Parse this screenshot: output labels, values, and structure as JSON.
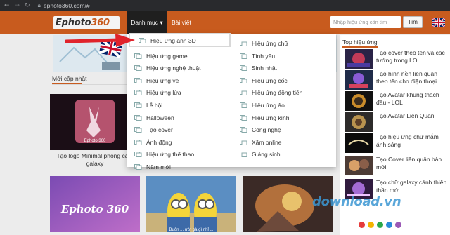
{
  "browser": {
    "back_icon": "arrow-left-icon",
    "forward_icon": "arrow-right-icon",
    "reload_icon": "reload-icon",
    "lock_icon": "lock-icon",
    "url": "ephoto360.com/#"
  },
  "header": {
    "logo_prefix": "Ephoto",
    "logo_suffix": "360",
    "menu_danhmuc": "Danh mục",
    "menu_baiviet": "Bài viết",
    "search_placeholder": "Nhập hiệu ứng cần tìm",
    "search_button": "Tìm",
    "flag_icon": "uk-flag-icon",
    "accent_color": "#c85b1e"
  },
  "dropdown": {
    "col1": [
      "Hiệu ứng ảnh 3D",
      "Hiệu ứng game",
      "Hiệu ứng nghệ thuật",
      "Hiệu ứng vẽ",
      "Hiệu ứng lửa",
      "Lễ hội",
      "Halloween",
      "Tạo cover",
      "Ảnh động",
      "Hiệu ứng thể thao",
      "Năm mới"
    ],
    "col2": [
      "Hiệu ứng chữ",
      "Tình yêu",
      "Sinh nhật",
      "Hiệu ứng cốc",
      "Hiệu ứng đồng tiền",
      "Hiệu ứng ảo",
      "Hiệu ứng kính",
      "Công nghệ",
      "Xăm online",
      "Giáng sinh"
    ],
    "item_icon": "photo-stack-icon"
  },
  "main": {
    "section_title": "Mới cập nhật",
    "cards": [
      {
        "caption": "Tạo logo Minimal phong cá... galaxy",
        "thumb_text": "Ephoto 360"
      },
      {
        "caption": "",
        "thumb_text": ""
      },
      {
        "caption": "",
        "thumb_text": ""
      }
    ],
    "card2_caption": "Buôn ... ười gà gì nhỉ ...",
    "card_bottom_left_text": "Ephoto 360"
  },
  "sidebar": {
    "title": "Top hiệu ứng",
    "items": [
      "Tạo cover theo tên và các tướng trong LOL",
      "Tạo hình nền liên quân theo tên cho điện thoại",
      "Tạo Avatar khung thách đấu - LOL",
      "Tạo Avatar Liên Quân",
      "Tạo hiệu ứng chữ mắm ánh sáng",
      "Tạo Cover liên quân bản mới",
      "Tạo chữ galaxy cánh thiên thần mới"
    ]
  },
  "watermark": {
    "text": "download.vn",
    "colors": [
      "#e63c3c",
      "#f4b400",
      "#2aa84a",
      "#2a8ad9",
      "#9b59b6"
    ]
  }
}
